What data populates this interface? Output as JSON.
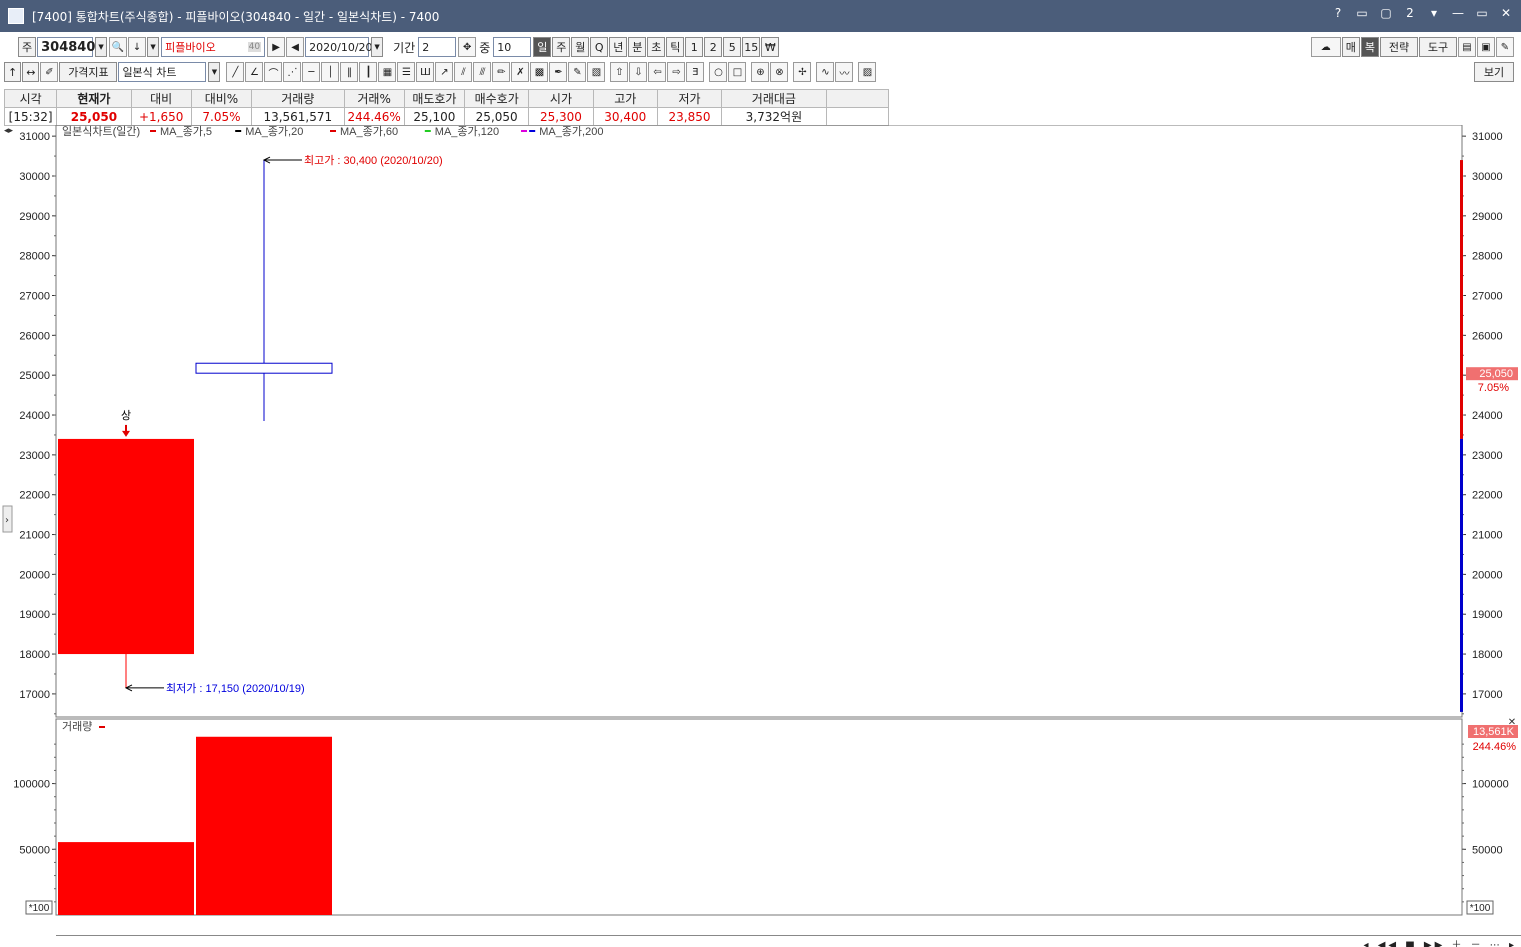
{
  "window": {
    "title": "[7400] 통합차트(주식종합) - 피플바이오(304840 - 일간 - 일본식차트) - 7400",
    "controls": [
      "?",
      "▭",
      "▢",
      "2",
      "▾",
      "—",
      "▭",
      "✕"
    ]
  },
  "toolbar1": {
    "market_label": "주",
    "code": "304840",
    "name": "피플바이오",
    "name_badge": "40",
    "date": "2020/10/20",
    "period_label": "기간",
    "period_value": "2",
    "count_label": "중",
    "count_value": "10",
    "timeframes": [
      "일",
      "주",
      "월",
      "Q",
      "년",
      "분",
      "초",
      "틱",
      "1",
      "2",
      "5",
      "15",
      "₩"
    ],
    "selected_timeframe": "일",
    "right_buttons": [
      "매",
      "복",
      "전략",
      "도구"
    ]
  },
  "toolbar2": {
    "arrows": [
      "↑",
      "↔"
    ],
    "indicator_button": "가격지표",
    "chart_type": "일본식 차트",
    "view_button": "보기"
  },
  "quote": {
    "headers": [
      "시각",
      "현재가",
      "대비",
      "대비%",
      "거래량",
      "거래%",
      "매도호가",
      "매수호가",
      "시가",
      "고가",
      "저가",
      "거래대금"
    ],
    "values": [
      "[15:32]",
      "25,050",
      "+1,650",
      "7.05%",
      "13,561,571",
      "244.46%",
      "25,100",
      "25,050",
      "25,300",
      "30,400",
      "23,850",
      "3,732억원"
    ]
  },
  "price_panel": {
    "legend": "일본식차트(일간)",
    "ma_legend": [
      "MA_종가,5",
      "MA_종가,20",
      "MA_종가,60",
      "MA_종가,120",
      "MA_종가,200"
    ],
    "ma_colors": [
      "#e00000",
      "#000000",
      "#e00000",
      "#22cc22",
      "#0000dd",
      "#dd00dd"
    ],
    "high_annotation": "최고가 : 30,400 (2020/10/20)",
    "low_annotation": "최저가 : 17,150 (2020/10/19)",
    "limit_up_marker": "상",
    "current_price_tag": "25,050",
    "current_change_tag": "7.05%"
  },
  "volume_panel": {
    "legend": "거래량",
    "volume_tag": "13,561K",
    "volume_change_tag": "244.46%",
    "unit_left": "*100",
    "unit_right": "*100"
  },
  "chart_data": [
    {
      "type": "candlestick",
      "title": "일본식차트(일간)",
      "x": [
        "2020/10/19",
        "2020/10/20"
      ],
      "open": [
        18000,
        25300
      ],
      "high": [
        23400,
        30400
      ],
      "low": [
        17150,
        23850
      ],
      "close": [
        23400,
        25050
      ],
      "colors": [
        "#ff0000",
        "#0000cc"
      ],
      "ylim": [
        16400,
        31200
      ],
      "yticks": [
        17000,
        18000,
        19000,
        20000,
        21000,
        22000,
        23000,
        24000,
        25000,
        26000,
        27000,
        28000,
        29000,
        30000,
        31000
      ]
    },
    {
      "type": "bar",
      "title": "거래량",
      "categories": [
        "2020/10/19",
        "2020/10/20"
      ],
      "values": [
        55470,
        135616
      ],
      "unit": "*100",
      "ylim": [
        0,
        140000
      ],
      "yticks": [
        50000,
        100000
      ],
      "colors": [
        "#ff0000",
        "#ff0000"
      ]
    }
  ]
}
